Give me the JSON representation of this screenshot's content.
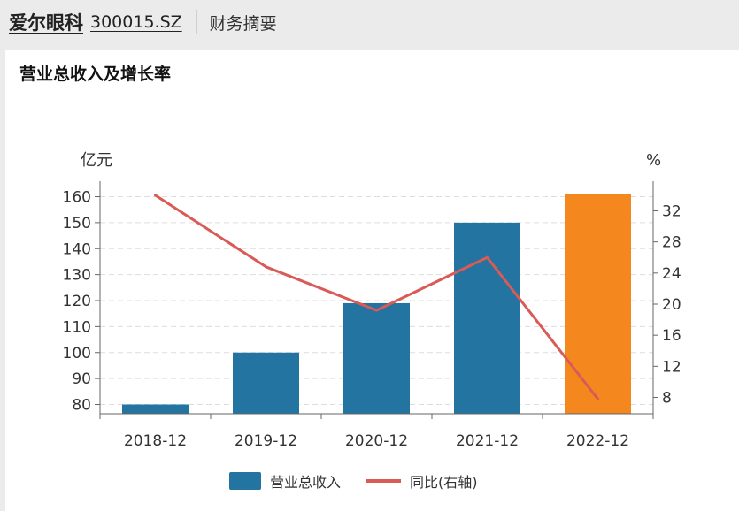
{
  "header": {
    "company": "爱尔眼科",
    "code": "300015.SZ",
    "section": "财务摘要"
  },
  "card": {
    "title": "营业总收入及增长率"
  },
  "colors": {
    "bar": "#2474a1",
    "bar_highlight": "#f5871f",
    "line": "#d95a56"
  },
  "chart_data": {
    "type": "bar",
    "categories": [
      "2018-12",
      "2019-12",
      "2020-12",
      "2021-12",
      "2022-12"
    ],
    "series": [
      {
        "name": "营业总收入",
        "type": "bar",
        "axis": "left",
        "values": [
          80,
          100,
          119,
          150,
          161
        ]
      },
      {
        "name": "同比(右轴)",
        "type": "line",
        "axis": "right",
        "values": [
          34,
          24.8,
          19.2,
          26,
          7.8
        ]
      }
    ],
    "y_left": {
      "label": "亿元",
      "ticks": [
        80,
        90,
        100,
        110,
        120,
        130,
        140,
        150,
        160
      ]
    },
    "y_right": {
      "label": "%",
      "ticks": [
        8,
        12,
        16,
        20,
        24,
        28,
        32
      ]
    },
    "highlight_last": true,
    "grid": true,
    "legend_position": "bottom"
  }
}
